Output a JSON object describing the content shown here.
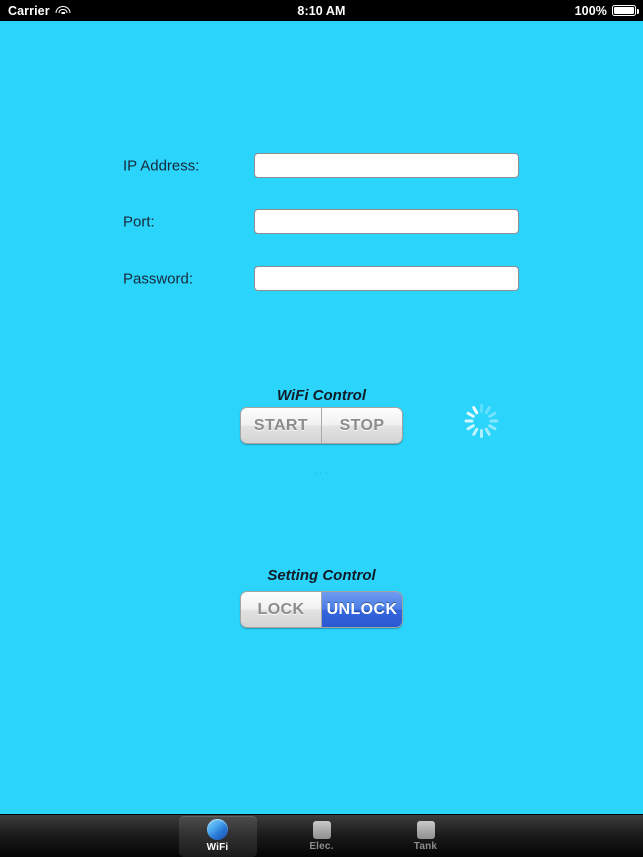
{
  "status_bar": {
    "carrier": "Carrier",
    "wifi_icon": "wifi-icon",
    "time": "8:10 AM",
    "battery_percent": "100%",
    "battery_icon": "battery-full-icon"
  },
  "theme": {
    "background": "#2ad4fb",
    "label_color": "#17293a",
    "selected_segment": "#3566dc"
  },
  "form": {
    "fields": [
      {
        "label": "IP Address:",
        "value": "",
        "placeholder": ""
      },
      {
        "label": "Port:",
        "value": "",
        "placeholder": ""
      },
      {
        "label": "Password:",
        "value": "",
        "placeholder": ""
      }
    ]
  },
  "wifi_control": {
    "title": "WiFi Control",
    "segments": [
      {
        "label": "START",
        "selected": false
      },
      {
        "label": "STOP",
        "selected": false
      }
    ],
    "status_text": "...",
    "spinner": "activity-indicator-icon"
  },
  "setting_control": {
    "title": "Setting Control",
    "segments": [
      {
        "label": "LOCK",
        "selected": false
      },
      {
        "label": "UNLOCK",
        "selected": true
      }
    ]
  },
  "tab_bar": {
    "tabs": [
      {
        "label": "WiFi",
        "icon": "globe-icon",
        "active": true
      },
      {
        "label": "Elec.",
        "icon": "square-icon",
        "active": false
      },
      {
        "label": "Tank",
        "icon": "square-icon",
        "active": false
      }
    ]
  }
}
